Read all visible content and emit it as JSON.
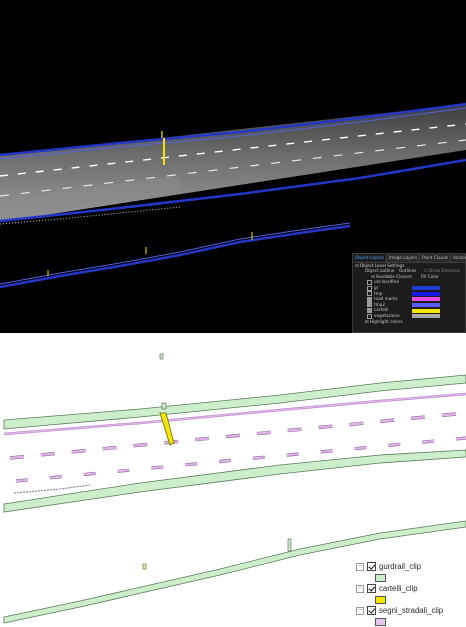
{
  "point_cloud_view": {
    "layer_panel": {
      "tabs": [
        "Object Layers",
        "Image Layers",
        "Point Clouds",
        "Vector Layers",
        "De"
      ],
      "active_tab": "Object Layers",
      "section_title": "Object Level Settings",
      "object_outline_label": "Object outline",
      "object_outline_value": "Outlines",
      "object_outline_option": "Draw Direction",
      "available_classes_label": "Available Classes",
      "color_column_label": "Fill Color",
      "classes": [
        {
          "name": "unclassified",
          "checked": false,
          "color": ""
        },
        {
          "name": "gr",
          "checked": false,
          "color": "#1f3bd6"
        },
        {
          "name": "tmp",
          "checked": false,
          "color": "#1a1ae8"
        },
        {
          "name": "road marks",
          "checked": true,
          "color": "#e84be8"
        },
        {
          "name": "tmp2",
          "checked": true,
          "color": "#5a5aff"
        },
        {
          "name": "cartelli",
          "checked": true,
          "color": "#f2e600"
        },
        {
          "name": "vegetazione",
          "checked": false,
          "color": "#a8a8a8"
        }
      ],
      "highlight_label": "Highlight colors"
    }
  },
  "vector_view": {
    "legend": [
      {
        "label": "gurdrail_clip",
        "checked": true,
        "collapse": "⊟",
        "swatch_color": "#cdeecb"
      },
      {
        "label": "cartelli_clip",
        "checked": true,
        "collapse": "⊟",
        "swatch_color": "#f2e600"
      },
      {
        "label": "segni_stradali_clip",
        "checked": true,
        "collapse": "⊟",
        "swatch_color": "#e6c6ee"
      }
    ]
  },
  "colors": {
    "guardrail_outline_blue": "#2436c8",
    "guardrail_fill_green": "#cdeecb",
    "road_mark_pink": "#e2b4ea",
    "sign_yellow": "#f2e600",
    "road_gray": "#6a6a6a"
  }
}
